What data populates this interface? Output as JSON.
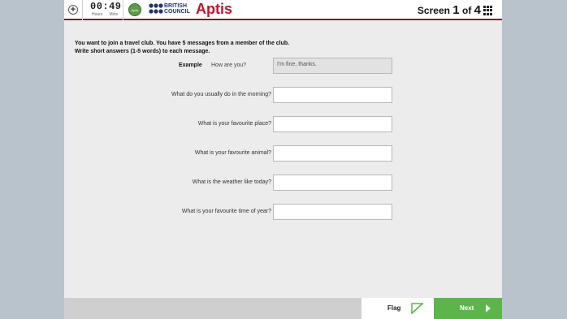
{
  "header": {
    "plus_symbol": "+",
    "timer": {
      "value": "00:49",
      "unit_hours": "Hours",
      "unit_mins": "Mins"
    },
    "badge": "Aptis",
    "brand_line1": "BRITISH",
    "brand_line2": "COUNCIL",
    "app_title": "Aptis",
    "screen": {
      "prefix": "Screen",
      "current": "1",
      "of": "of",
      "total": "4"
    }
  },
  "instructions": {
    "line1": "You want to join a travel club. You have 5 messages from a member of the club.",
    "line2": "Write short answers (1-5 words) to each message."
  },
  "example": {
    "label": "Example",
    "question": "How are you?",
    "answer": "I'm fine, thanks."
  },
  "questions": [
    {
      "label": "What do you usually do in the morning?",
      "value": ""
    },
    {
      "label": "What is your favourite place?",
      "value": ""
    },
    {
      "label": "What is your favourite animal?",
      "value": ""
    },
    {
      "label": "What is the weather like today?",
      "value": ""
    },
    {
      "label": "What is your favourite time of year?",
      "value": ""
    }
  ],
  "footer": {
    "flag_label": "Flag",
    "next_label": "Next"
  },
  "colors": {
    "brand_red": "#c8102e",
    "header_rule": "#7d1c2d",
    "next_green": "#5bb54a",
    "bc_navy": "#23346b"
  }
}
